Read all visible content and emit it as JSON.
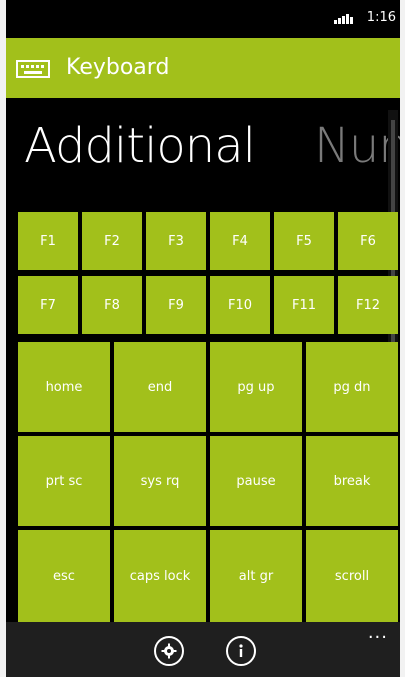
{
  "status": {
    "time": "1:16"
  },
  "app": {
    "title": "Keyboard"
  },
  "pivot": {
    "active": "Additional",
    "next": "Num"
  },
  "keys": {
    "row1": [
      "F1",
      "F2",
      "F3",
      "F4",
      "F5",
      "F6"
    ],
    "row2": [
      "F7",
      "F8",
      "F9",
      "F10",
      "F11",
      "F12"
    ],
    "row3": [
      "home",
      "end",
      "pg up",
      "pg dn"
    ],
    "row4": [
      "prt sc",
      "sys rq",
      "pause",
      "break"
    ],
    "row5": [
      "esc",
      "caps lock",
      "alt gr",
      "scroll"
    ]
  },
  "appbar_buttons": {
    "settings": "settings-icon",
    "info": "info-icon",
    "more": "..."
  },
  "colors": {
    "accent": "#a2c01b",
    "background": "#000000",
    "bottom_bar": "#1f1f1f"
  }
}
